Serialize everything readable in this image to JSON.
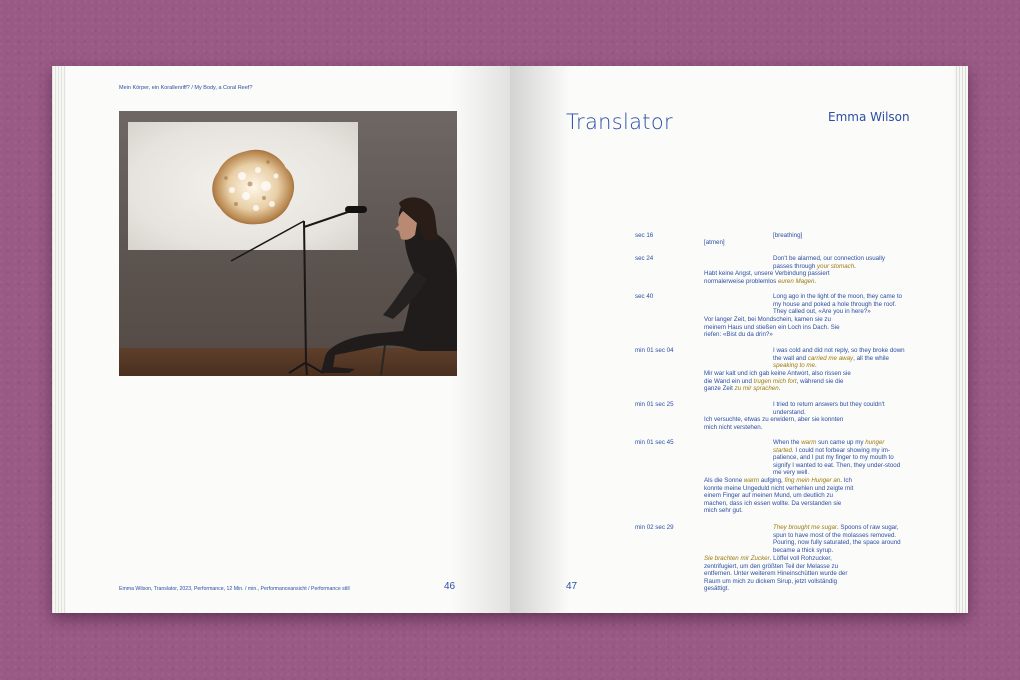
{
  "left_page": {
    "running_head": "Mein Körper, ein Korallenriff? / My Body, a Coral Reef?",
    "caption": "Emma Wilson, Translator, 2023, Performance, 12 Min. / min., Performanceansicht / Performance still",
    "page_number": "46"
  },
  "right_page": {
    "title": "Translator",
    "author": "Emma Wilson",
    "page_number": "47",
    "entries": [
      {
        "time": "sec 16",
        "en": "[breathing]",
        "de": "[atmen]"
      },
      {
        "time": "sec 24",
        "en": "Don't be alarmed, our connection usually passes through <em>your stomach</em>.",
        "de": "Habt keine Angst, unsere Verbindung passiert normalerweise problemlos <em>euren Magen</em>."
      },
      {
        "time": "sec 40",
        "en": "Long ago in the light of the moon, they came to my house and poked a hole through the roof. They called out, «Are you in here?»",
        "de": "Vor langer Zeit, bei Mondschein, kamen sie zu meinem Haus und stießen ein Loch ins Dach. Sie riefen: «Bist du da drin?»"
      },
      {
        "time": "min 01 sec 04",
        "en": "I was cold and did not reply, so they broke down the wall and <em>carried me away</em>, all the while <em>speaking to me</em>.",
        "de": "Mir war kalt und ich gab keine Antwort, also rissen sie die Wand ein und <em>trugen mich fort</em>, während sie die ganze Zeit <em>zu mir sprachen</em>."
      },
      {
        "time": "min 01 sec 25",
        "en": "I tried to return answers but they couldn't understand.",
        "de": "Ich versuchte, etwas zu erwidern, aber sie konnten mich nicht verstehen."
      },
      {
        "time": "min 01 sec 45",
        "en": "When the <em>warm</em> sun came up my <em>hunger started</em>. I could not forbear showing my im-patience, and I put my finger to my mouth to signify I wanted to eat. Then, they under-stood me very well.",
        "de": "Als die Sonne <em>warm</em> aufging, <em>fing mein Hunger an</em>. Ich konnte meine Ungeduld nicht verhehlen und zeigte mit einem Finger auf meinen Mund, um deutlich zu machen, dass ich essen wollte. Da verstanden sie mich sehr gut."
      },
      {
        "time": "min 02 sec 29",
        "en": "<em>They brought me sugar</em>. Spoons of raw sugar, spun to have most of the molasses removed. Pouring, now fully saturated, the space around became a thick syrup.",
        "de": "<em>Sie brachten mir Zucker</em>. Löffel voll Rohzucker, zentrifugiert, um den größten Teil der Melasse zu entfernen. Unter weiterem Hineinschütten wurde der Raum um mich zu dickem Sirup, jetzt vollständig gesättigt."
      }
    ]
  },
  "colors": {
    "background": "#9a5a86",
    "page": "#fbfbf9",
    "text_accent": "#2b4fa3",
    "highlight": "#9a7a10"
  }
}
